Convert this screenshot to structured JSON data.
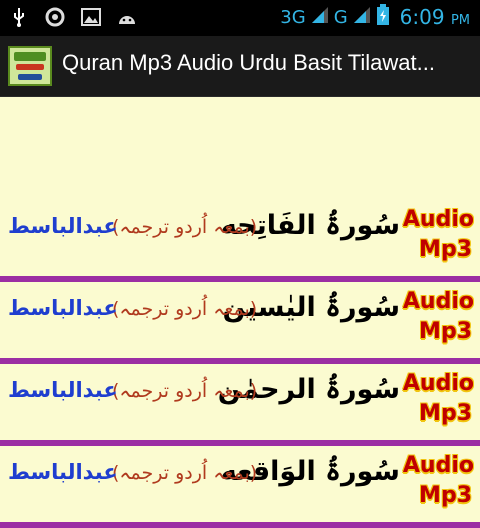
{
  "status_bar": {
    "network_3g": "3G",
    "network_g": "G",
    "time": "6:09",
    "ampm": "PM"
  },
  "action_bar": {
    "title": "Quran Mp3 Audio Urdu Basit Tilawat..."
  },
  "items": [
    {
      "surah": "سُورۃُ الفَاتِحه",
      "subtitle": "(بمعہ اُردو ترجمہ)",
      "reciter": "عبدالباسط",
      "badge_top": "Audio",
      "badge_bottom": "Mp3"
    },
    {
      "surah": "سُورۃُ الیٰسین",
      "subtitle": "(بمعہ اُردو ترجمہ)",
      "reciter": "عبدالباسط",
      "badge_top": "Audio",
      "badge_bottom": "Mp3"
    },
    {
      "surah": "سُورۃُ الرحمٰن",
      "subtitle": "(بمعہ اُردو ترجمہ)",
      "reciter": "عبدالباسط",
      "badge_top": "Audio",
      "badge_bottom": "Mp3"
    },
    {
      "surah": "سُورۃُ الوَاقعه",
      "subtitle": "(بمعہ اُردو ترجمہ)",
      "reciter": "عبدالباسط",
      "badge_top": "Audio",
      "badge_bottom": "Mp3"
    }
  ],
  "colors": {
    "background": "#fbfbd0",
    "divider": "#9b2ea3",
    "badge_text": "#c00000",
    "badge_outline": "#f1c40f",
    "reciter_text": "#1f3ecf",
    "subtitle_text": "#b03a1e",
    "status_accent": "#33b5e5"
  }
}
